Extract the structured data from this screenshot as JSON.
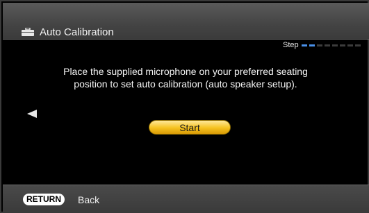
{
  "header": {
    "icon": "toolbox-icon",
    "title": "Auto Calibration"
  },
  "progress": {
    "label": "Step",
    "total_steps": 8,
    "current_step": 2,
    "active_color": "#4a90e8"
  },
  "main": {
    "message_line1": "Place the supplied microphone on your preferred seating",
    "message_line2": "position to set auto calibration (auto speaker setup).",
    "back_arrow_icon": "left-arrow-icon",
    "start_label": "Start",
    "start_color": "#f5c21e"
  },
  "footer": {
    "return_label": "RETURN",
    "back_label": "Back"
  }
}
